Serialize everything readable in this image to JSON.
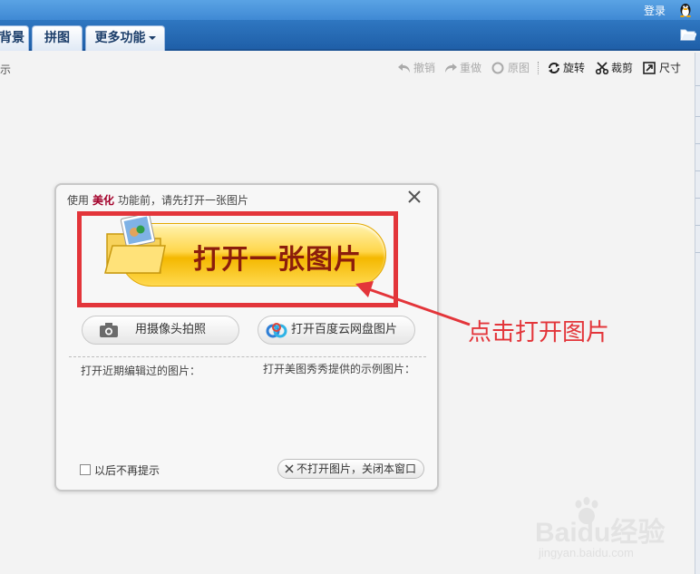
{
  "topbar": {
    "login_label": "登录"
  },
  "tabs": [
    {
      "label": "背景"
    },
    {
      "label": "拼图"
    },
    {
      "label": "更多功能"
    }
  ],
  "main": {
    "left_label": "示"
  },
  "toolbar": {
    "undo": "撤销",
    "redo": "重做",
    "original": "原图",
    "rotate": "旋转",
    "crop": "裁剪",
    "size": "尺寸"
  },
  "dialog": {
    "title_prefix": "使用",
    "title_highlight": "美化",
    "title_suffix": "功能前，请先打开一张图片",
    "open_button": "打开一张图片",
    "camera_button": "用摄像头拍照",
    "cloud_button": "打开百度云网盘图片",
    "recent_label": "打开近期编辑过的图片：",
    "samples_label": "打开美图秀秀提供的示例图片：",
    "dont_show_label": "以后不再提示",
    "dont_show_checked": false,
    "no_open_button": "不打开图片，关闭本窗口"
  },
  "annotation": {
    "text": "点击打开图片",
    "color": "#e3353a"
  },
  "watermark": {
    "main": "Baidu经验",
    "sub": "jingyan.baidu.com"
  },
  "colors": {
    "topbar": "#3f89d4",
    "tabbar": "#1f5fa8",
    "accent_red": "#e3353a",
    "button_yellow": "#ffd64a"
  }
}
